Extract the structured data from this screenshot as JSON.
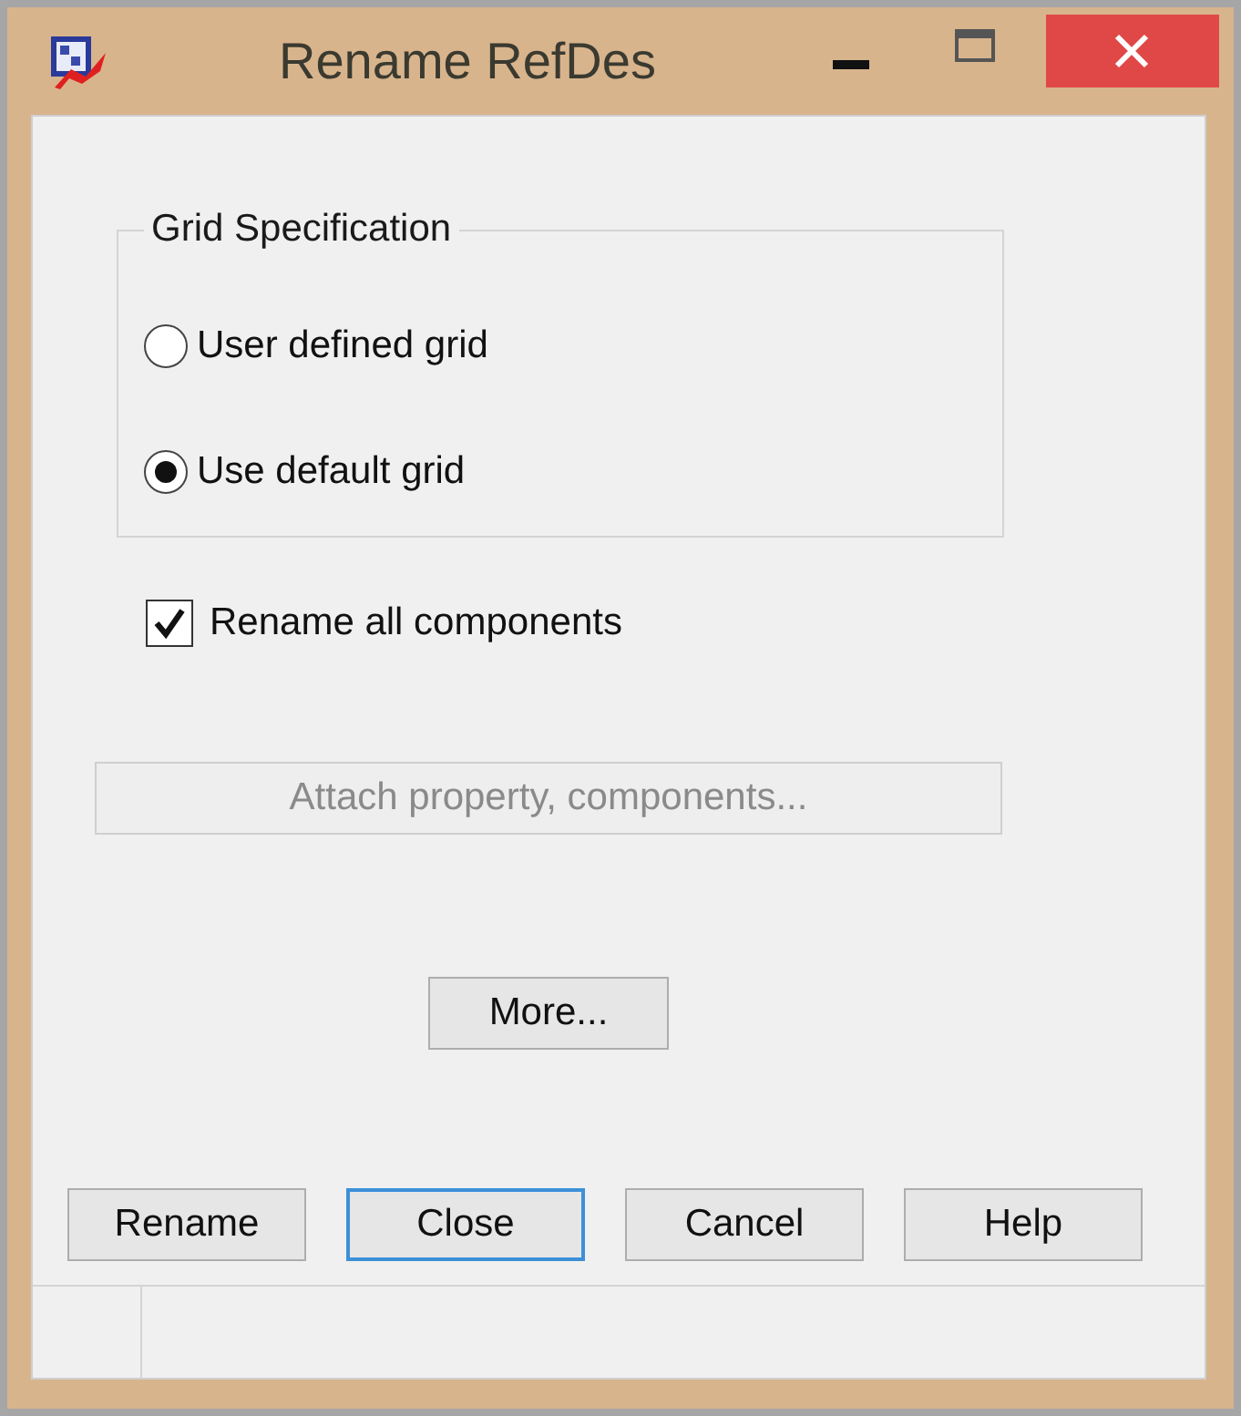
{
  "window": {
    "title": "Rename RefDes"
  },
  "grid_specification": {
    "label": "Grid Specification",
    "options": [
      {
        "label": "User defined grid",
        "selected": false
      },
      {
        "label": "Use default grid",
        "selected": true
      }
    ]
  },
  "rename_all": {
    "label": "Rename all components",
    "checked": true
  },
  "attach_button": {
    "label": "Attach property, components...",
    "disabled": true
  },
  "more_button": {
    "label": "More..."
  },
  "buttons": [
    {
      "label": "Rename",
      "focused": false
    },
    {
      "label": "Close",
      "focused": true
    },
    {
      "label": "Cancel",
      "focused": false
    },
    {
      "label": "Help",
      "focused": false
    }
  ]
}
